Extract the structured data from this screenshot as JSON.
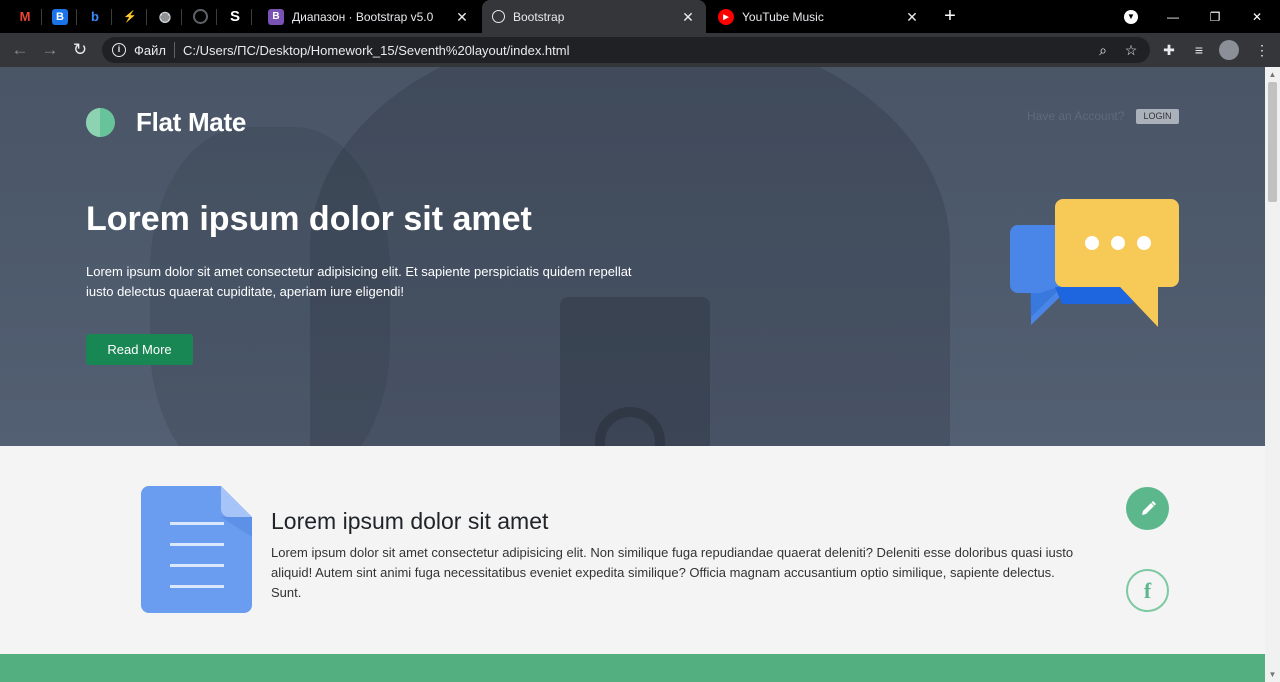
{
  "browser": {
    "pinned_tabs": [
      {
        "icon": "gmail-icon",
        "letter": "M",
        "color": "#1f1f1f",
        "fg": "#ea4335"
      },
      {
        "icon": "calendar-icon",
        "letter": "B",
        "color": "#1a73e8",
        "fg": "#ffffff"
      },
      {
        "icon": "behance-icon",
        "letter": "b",
        "color": "#000000",
        "fg": "#3d8bfd"
      },
      {
        "icon": "lightning-icon",
        "letter": "⚡",
        "color": "#000000",
        "fg": "#4a7cf6"
      },
      {
        "icon": "drop-icon",
        "letter": "◍",
        "color": "#000000",
        "fg": "#cfd2d6"
      },
      {
        "icon": "github-icon",
        "letter": "●",
        "color": "#000000",
        "fg": "#5f6368"
      },
      {
        "icon": "s-icon",
        "letter": "S",
        "color": "#000000",
        "fg": "#ffffff"
      }
    ],
    "tabs": [
      {
        "title": "Диапазон · Bootstrap v5.0",
        "favicon_letter": "B",
        "favicon_color": "#7952b3"
      },
      {
        "title": "Bootstrap",
        "favicon_letter": "◎",
        "favicon_color": "#35363a"
      },
      {
        "title": "YouTube Music",
        "favicon_letter": "▶",
        "favicon_color": "#ff0000"
      }
    ],
    "close_glyph": "✕",
    "new_tab_glyph": "+",
    "address": {
      "scheme_label": "Файл",
      "url": "C:/Users/ПС/Desktop/Homework_15/Seventh%20layout/index.html"
    }
  },
  "page": {
    "brand": "Flat Mate",
    "have_account": "Have an Account?",
    "login_label": "LOGIN",
    "hero_title": "Lorem ipsum dolor sit amet",
    "hero_text": "Lorem ipsum dolor sit amet consectetur adipisicing elit. Et sapiente perspiciatis quidem repellat iusto delectus quaerat cupiditate, aperiam iure eligendi!",
    "read_more": "Read More",
    "feature_title": "Lorem ipsum dolor sit amet",
    "feature_text": "Lorem ipsum dolor sit amet consectetur adipisicing elit. Non similique fuga repudiandae quaerat deleniti? Deleniti esse doloribus quasi iusto aliquid! Autem sint animi fuga necessitatibus eveniet expedita similique? Officia magnam accusantium optio similique, sapiente delectus. Sunt.",
    "fb_letter": "f"
  },
  "colors": {
    "accent_green": "#198754",
    "mint": "#5cb88c",
    "chat_blue": "#4a86e8",
    "chat_yellow": "#f7c956",
    "doc_blue": "#6a9cf0"
  }
}
